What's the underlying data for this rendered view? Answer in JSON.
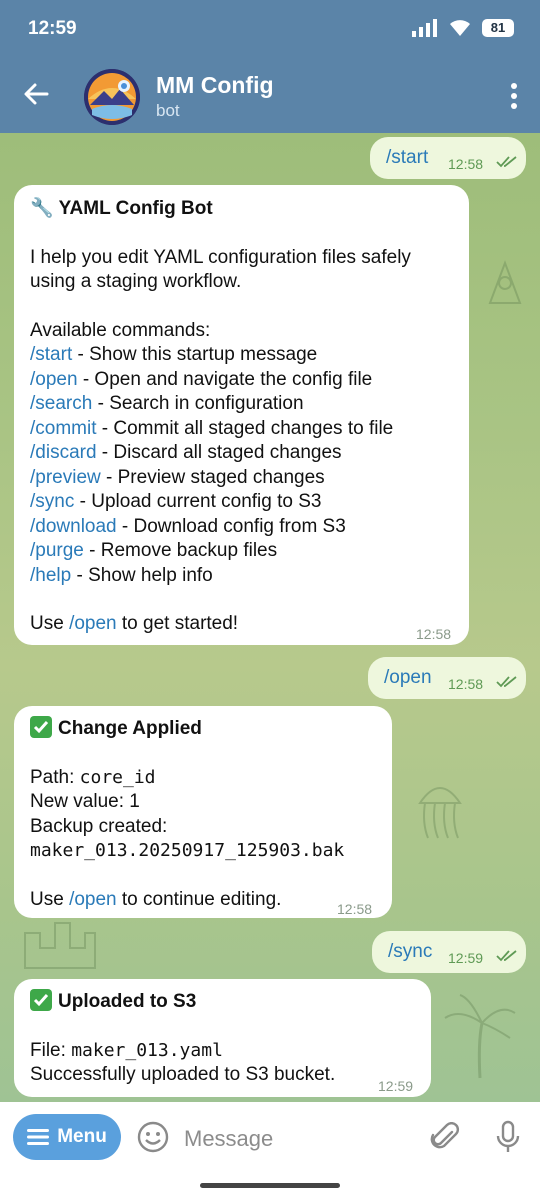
{
  "status_bar": {
    "time": "12:59",
    "battery": "81"
  },
  "header": {
    "title": "MM Config",
    "subtitle": "bot"
  },
  "messages": [
    {
      "id": "m1",
      "direction": "out",
      "text": "/start",
      "time": "12:58"
    },
    {
      "id": "m2",
      "direction": "in",
      "time": "12:58",
      "title": "YAML Config Bot",
      "intro": [
        "I help you edit YAML configuration files safely",
        "using a staging workflow."
      ],
      "commands_heading": "Available commands:",
      "commands": [
        {
          "cmd": "/start",
          "desc": " - Show this startup message"
        },
        {
          "cmd": "/open",
          "desc": " - Open and navigate the config file"
        },
        {
          "cmd": "/search",
          "desc": " - Search in configuration"
        },
        {
          "cmd": "/commit",
          "desc": " - Commit all staged changes to file"
        },
        {
          "cmd": "/discard",
          "desc": " - Discard all staged changes"
        },
        {
          "cmd": "/preview",
          "desc": " - Preview staged changes"
        },
        {
          "cmd": "/sync",
          "desc": " - Upload current config to S3"
        },
        {
          "cmd": "/download",
          "desc": " - Download config from S3"
        },
        {
          "cmd": "/purge",
          "desc": " - Remove backup files"
        },
        {
          "cmd": "/help",
          "desc": " - Show help info"
        }
      ],
      "footer": {
        "before": "Use ",
        "cmd": "/open",
        "after": " to get started!"
      }
    },
    {
      "id": "m3",
      "direction": "out",
      "text": "/open",
      "time": "12:58"
    },
    {
      "id": "m4",
      "direction": "in",
      "time": "12:58",
      "title": "Change Applied",
      "path_label": "Path: ",
      "path_value": "core_id",
      "new_value_line": "New value: 1",
      "backup_label": "Backup created:",
      "backup_file": "maker_013.20250917_125903.bak",
      "footer": {
        "before": "Use ",
        "cmd": "/open",
        "after": " to continue editing."
      }
    },
    {
      "id": "m5",
      "direction": "out",
      "text": "/sync",
      "time": "12:59"
    },
    {
      "id": "m6",
      "direction": "in",
      "time": "12:59",
      "title": "Uploaded to S3",
      "file_label": "File: ",
      "file_value": "maker_013.yaml",
      "result": "Successfully uploaded to S3 bucket."
    }
  ],
  "input_bar": {
    "menu_label": "Menu",
    "placeholder": "Message"
  },
  "colors": {
    "header": "#5b84a8",
    "link": "#2a7ab8",
    "outgoing_bubble": "#eef7dd",
    "menu_button": "#5aa0dd",
    "check_mark": "#5f9a55"
  }
}
